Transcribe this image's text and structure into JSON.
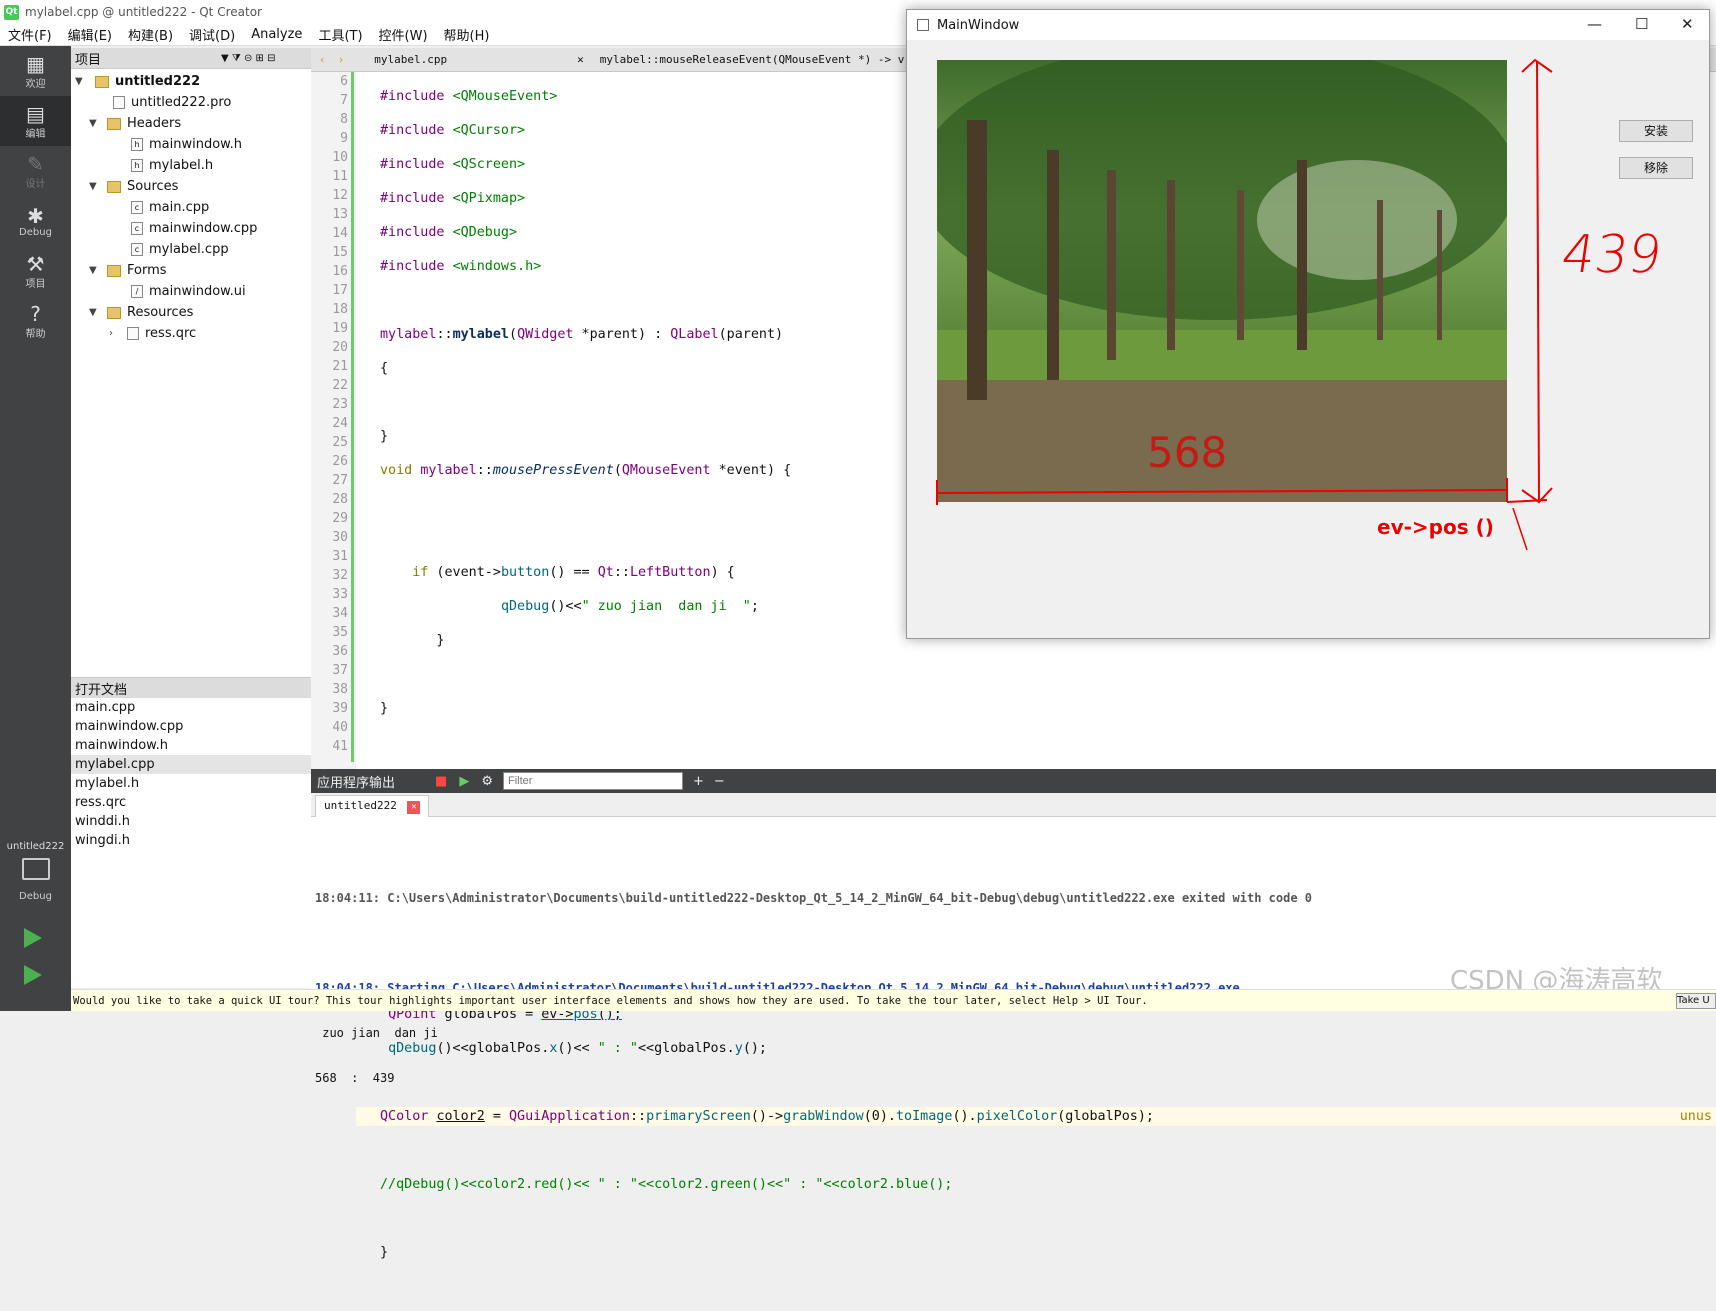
{
  "window_title": "mylabel.cpp @ untitled222 - Qt Creator",
  "menu": [
    "文件(F)",
    "编辑(E)",
    "构建(B)",
    "调试(D)",
    "Analyze",
    "工具(T)",
    "控件(W)",
    "帮助(H)"
  ],
  "modes": [
    {
      "label": "欢迎",
      "icon": "welcome-grid-icon"
    },
    {
      "label": "编辑",
      "icon": "edit-doc-icon"
    },
    {
      "label": "设计",
      "icon": "design-pencil-icon"
    },
    {
      "label": "Debug",
      "icon": "debug-bug-icon"
    },
    {
      "label": "项目",
      "icon": "project-wrench-icon"
    },
    {
      "label": "帮助",
      "icon": "help-question-icon"
    }
  ],
  "kit": {
    "name": "untitled222",
    "mode": "Debug"
  },
  "project_panel": {
    "title": "项目"
  },
  "tree": {
    "root": "untitled222",
    "pro": "untitled222.pro",
    "headers": "Headers",
    "header_files": [
      "mainwindow.h",
      "mylabel.h"
    ],
    "sources": "Sources",
    "source_files": [
      "main.cpp",
      "mainwindow.cpp",
      "mylabel.cpp"
    ],
    "forms": "Forms",
    "form_files": [
      "mainwindow.ui"
    ],
    "resources": "Resources",
    "resource_files": [
      "ress.qrc"
    ]
  },
  "open_docs": {
    "title": "打开文档",
    "items": [
      "main.cpp",
      "mainwindow.cpp",
      "mainwindow.h",
      "mylabel.cpp",
      "mylabel.h",
      "ress.qrc",
      "winddi.h",
      "wingdi.h"
    ],
    "selected": 3
  },
  "editor": {
    "file_tab": "mylabel.cpp",
    "symbol": "mylabel::mouseReleaseEvent(QMouseEvent *) -> v",
    "warning": "unus",
    "lines": [
      6,
      7,
      8,
      9,
      10,
      11,
      12,
      13,
      14,
      15,
      16,
      17,
      18,
      19,
      20,
      21,
      22,
      23,
      24,
      25,
      26,
      27,
      28,
      29,
      30,
      31,
      32,
      33,
      34,
      35,
      36,
      37,
      38,
      39,
      40,
      41
    ]
  },
  "output": {
    "title": "应用程序输出",
    "filter_placeholder": "Filter",
    "tab": "untitled222",
    "lines": [
      "",
      "18:04:11: C:\\Users\\Administrator\\Documents\\build-untitled222-Desktop_Qt_5_14_2_MinGW_64_bit-Debug\\debug\\untitled222.exe exited with code 0",
      "",
      "18:04:18: Starting C:\\Users\\Administrator\\Documents\\build-untitled222-Desktop_Qt_5_14_2_MinGW_64_bit-Debug\\debug\\untitled222.exe ...",
      " zuo jian  dan ji",
      "568  :  439"
    ]
  },
  "tour_bar": "Would you like to take a quick UI tour? This tour highlights important user interface elements and shows how they are used. To take the tour later, select Help > UI Tour.",
  "tour_button": "Take U",
  "mainwindow": {
    "title": "MainWindow",
    "buttons": [
      "安装",
      "移除"
    ],
    "annotations": {
      "height": "439",
      "width": "568",
      "pos": "ev->pos ()"
    }
  },
  "watermark": "CSDN @海涛高软"
}
